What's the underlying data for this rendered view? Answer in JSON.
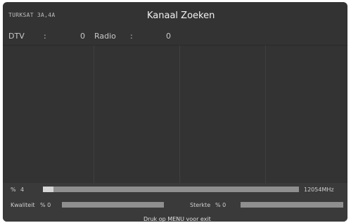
{
  "header": {
    "satellite": "TURKSAT 3A,4A",
    "title": "Kanaal Zoeken"
  },
  "counts": {
    "dtv_label": "DTV",
    "dtv_sep": ":",
    "dtv_value": "0",
    "radio_label": "Radio",
    "radio_sep": ":",
    "radio_value": "0"
  },
  "progress": {
    "percent_label": "%",
    "percent_value": "4",
    "frequency": "12054MHz",
    "fraction": 0.04
  },
  "signal": {
    "quality_label": "Kwaliteit",
    "quality_value": "% 0",
    "strength_label": "Sterkte",
    "strength_value": "% 0"
  },
  "footer": {
    "hint": "Druk op MENU voor exit"
  },
  "colors": {
    "background": "#333333",
    "bar_track": "#8f8f8f",
    "bar_fill": "#d6d6d6"
  }
}
